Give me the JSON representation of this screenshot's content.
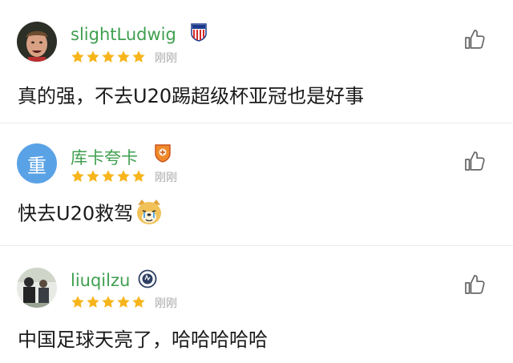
{
  "comments": [
    {
      "username": "slightLudwig",
      "badge_icon": "atletico-crest-icon",
      "rating": 5,
      "time": "刚刚",
      "text": "真的强，不去U20踢超级杯亚冠也是好事",
      "avatar_icon": "footballer-photo-avatar"
    },
    {
      "username": "库卡夸卡",
      "badge_icon": "orange-club-crest-icon",
      "rating": 5,
      "time": "刚刚",
      "text": "快去U20救驾",
      "avatar_letter": "重",
      "avatar_color": "#5aa2e6",
      "emoji_icon": "crying-dog-emoji"
    },
    {
      "username": "liuqilzu",
      "badge_icon": "verified-crest-icon",
      "rating": 5,
      "time": "刚刚",
      "text": "中国足球天亮了，哈哈哈哈哈",
      "avatar_icon": "group-photo-avatar"
    }
  ],
  "colors": {
    "username": "#3f9f4f",
    "star": "#f7b51c",
    "time": "#a8a8a8",
    "text": "#1a1a1a"
  }
}
